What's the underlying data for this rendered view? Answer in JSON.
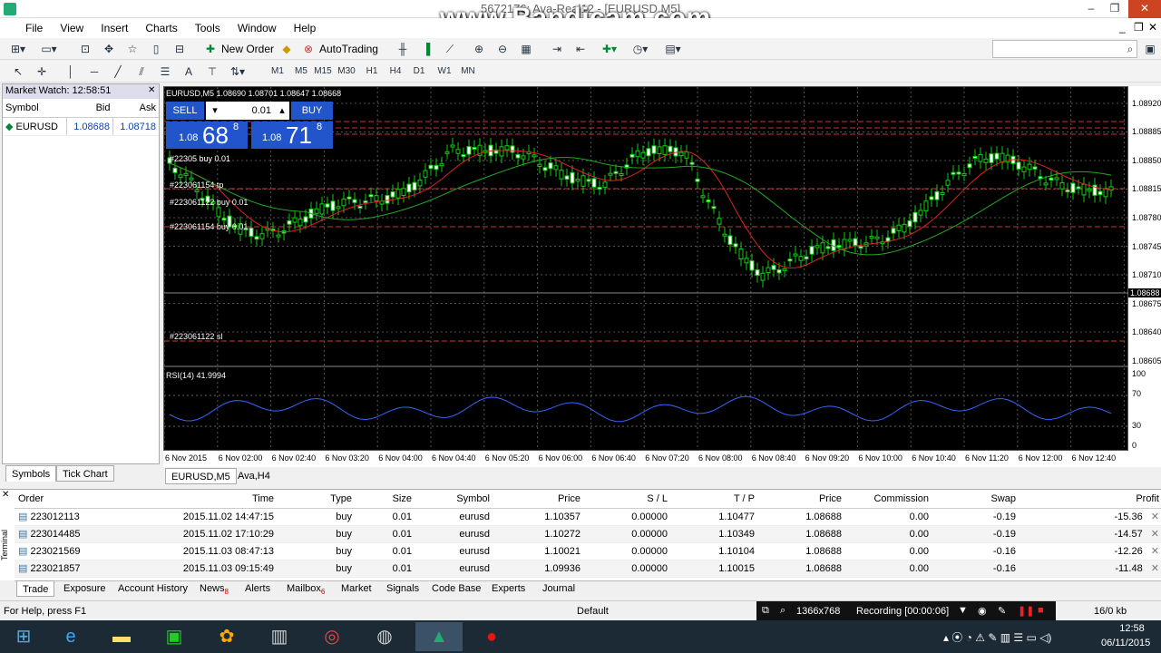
{
  "window": {
    "title": "5672176: Ava-Real12 - [EURUSD,M5]",
    "watermark": "www.Bandicam.com",
    "min": "–",
    "restore": "❐",
    "close": "✕"
  },
  "menu": [
    "File",
    "View",
    "Insert",
    "Charts",
    "Tools",
    "Window",
    "Help"
  ],
  "toolbar": {
    "new_order": "New Order",
    "autotrading": "AutoTrading"
  },
  "timeframes": [
    "M1",
    "M5",
    "M15",
    "M30",
    "H1",
    "H4",
    "D1",
    "W1",
    "MN"
  ],
  "market_watch": {
    "title": "Market Watch: 12:58:51",
    "cols": [
      "Symbol",
      "Bid",
      "Ask"
    ],
    "rows": [
      {
        "symbol": "EURUSD",
        "bid": "1.08688",
        "ask": "1.08718"
      }
    ],
    "tabs": [
      "Symbols",
      "Tick Chart"
    ]
  },
  "chart": {
    "header": "EURUSD,M5  1.08690 1.08701 1.08647 1.08668",
    "sell": "SELL",
    "buy": "BUY",
    "lot": "0.01",
    "sell_big": "68",
    "sell_sup": "8",
    "sell_pre": "1.08",
    "buy_big": "71",
    "buy_sup": "8",
    "buy_pre": "1.08",
    "order_labels": [
      "#22305      buy 0.01",
      "#223061154 tp",
      "#223061122 buy 0.01",
      "#223061154 buy 0.01",
      "#223061122 sl"
    ],
    "price_ticks": [
      "1.08920",
      "1.08885",
      "1.08850",
      "1.08815",
      "1.08780",
      "1.08745",
      "1.08710",
      "1.08688",
      "1.08675",
      "1.08640",
      "1.08605"
    ],
    "rsi_label": "RSI(14) 41.9994",
    "rsi_ticks": [
      "100",
      "70",
      "30",
      "0"
    ],
    "time_ticks": [
      "6 Nov 2015",
      "6 Nov 02:00",
      "6 Nov 02:40",
      "6 Nov 03:20",
      "6 Nov 04:00",
      "6 Nov 04:40",
      "6 Nov 05:20",
      "6 Nov 06:00",
      "6 Nov 06:40",
      "6 Nov 07:20",
      "6 Nov 08:00",
      "6 Nov 08:40",
      "6 Nov 09:20",
      "6 Nov 10:00",
      "6 Nov 10:40",
      "6 Nov 11:20",
      "6 Nov 12:00",
      "6 Nov 12:40"
    ],
    "tabs": [
      "EURUSD,M5",
      "Ava,H4"
    ]
  },
  "terminal": {
    "cols": [
      "Order",
      "Time",
      "Type",
      "Size",
      "Symbol",
      "Price",
      "S / L",
      "T / P",
      "Price",
      "Commission",
      "Swap",
      "Profit"
    ],
    "rows": [
      [
        "223012113",
        "2015.11.02 14:47:15",
        "buy",
        "0.01",
        "eurusd",
        "1.10357",
        "0.00000",
        "1.10477",
        "1.08688",
        "0.00",
        "-0.19",
        "-15.36"
      ],
      [
        "223014485",
        "2015.11.02 17:10:29",
        "buy",
        "0.01",
        "eurusd",
        "1.10272",
        "0.00000",
        "1.10349",
        "1.08688",
        "0.00",
        "-0.19",
        "-14.57"
      ],
      [
        "223021569",
        "2015.11.03 08:47:13",
        "buy",
        "0.01",
        "eurusd",
        "1.10021",
        "0.00000",
        "1.10104",
        "1.08688",
        "0.00",
        "-0.16",
        "-12.26"
      ],
      [
        "223021857",
        "2015.11.03 09:15:49",
        "buy",
        "0.01",
        "eurusd",
        "1.09936",
        "0.00000",
        "1.10015",
        "1.08688",
        "0.00",
        "-0.16",
        "-11.48"
      ]
    ],
    "tabs": [
      "Trade",
      "Exposure",
      "Account History",
      "News",
      "Alerts",
      "Mailbox",
      "Market",
      "Signals",
      "Code Base",
      "Experts",
      "Journal"
    ],
    "news_count": "8",
    "mailbox_count": "6",
    "side_label": "Terminal"
  },
  "status": {
    "help": "For Help, press F1",
    "profile": "Default",
    "resolution": "1366x768",
    "recording": "Recording [00:00:06]",
    "traffic": "16/0 kb"
  },
  "taskbar": {
    "time": "12:58",
    "date": "06/11/2015"
  }
}
